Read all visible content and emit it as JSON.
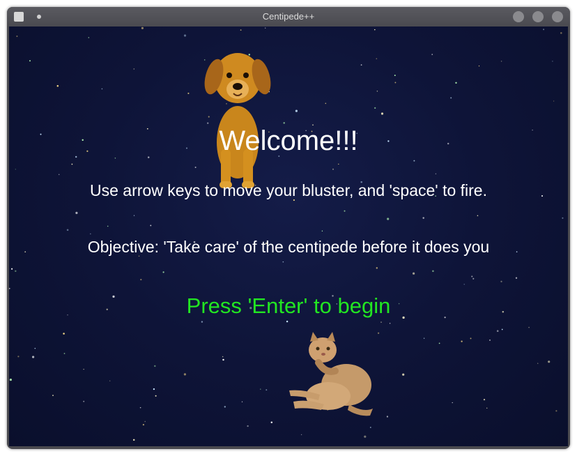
{
  "window": {
    "title": "Centipede++"
  },
  "screen": {
    "welcome": "Welcome!!!",
    "instructions": "Use arrow keys to move your bluster, and 'space' to fire.",
    "objective": "Objective: 'Take care' of the centipede before it does you",
    "prompt": "Press 'Enter' to begin"
  },
  "colors": {
    "background": "#0e1438",
    "text": "#ffffff",
    "prompt": "#22e622"
  },
  "sprites": [
    "puppy-sprite",
    "cat-sprite"
  ]
}
